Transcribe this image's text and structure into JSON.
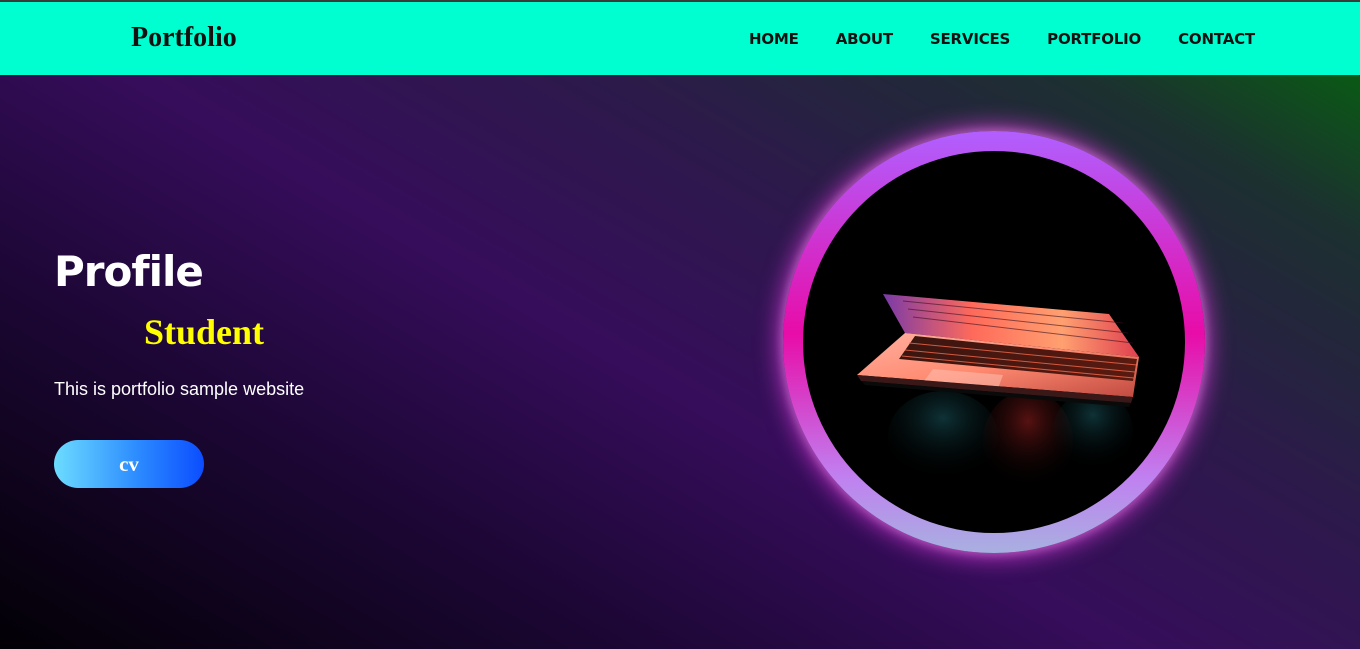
{
  "header": {
    "logo": "Portfolio",
    "nav": [
      "HOME",
      "ABOUT",
      "SERVICES",
      "PORTFOLIO",
      "CONTACT"
    ]
  },
  "hero": {
    "title": "Profile",
    "subtitle": "Student",
    "description": "This is portfolio sample website",
    "button_label": "cv",
    "image": "laptop-photo"
  },
  "colors": {
    "header_bg": "#00ffd0",
    "accent_yellow": "#ffff00",
    "ring_pink": "#e80ca8",
    "ring_purple": "#b060ff"
  }
}
